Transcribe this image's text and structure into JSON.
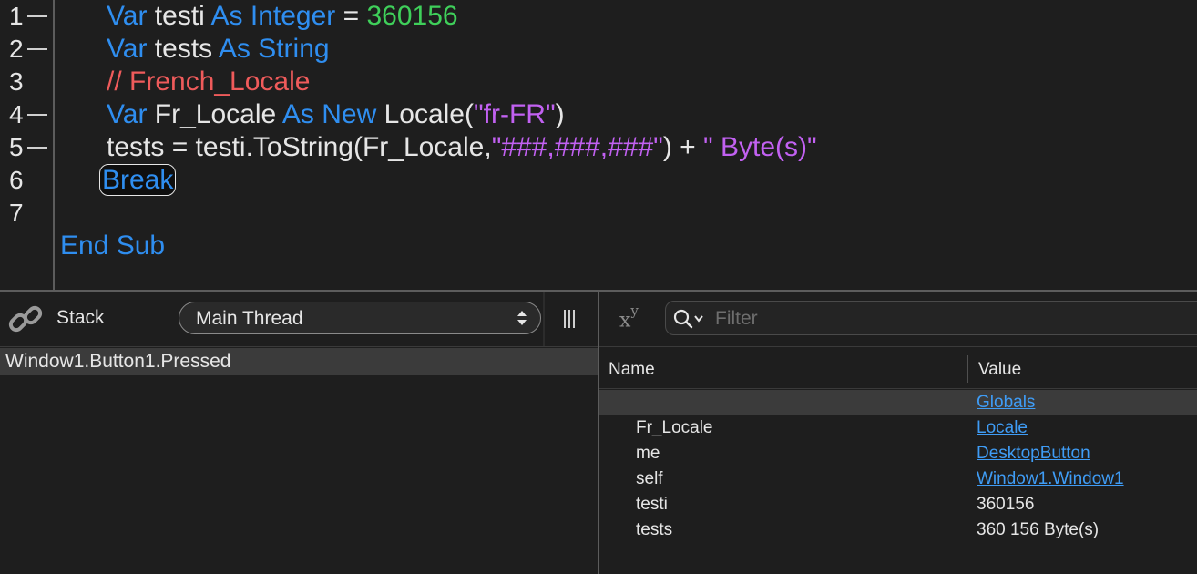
{
  "editor": {
    "line_numbers": [
      "1",
      "2",
      "3",
      "4",
      "5",
      "6",
      "7"
    ],
    "lines": {
      "l1": {
        "kw1": "Var",
        "name": " testi ",
        "kw2": "As Integer",
        "eq": " = ",
        "num": "360156"
      },
      "l2": {
        "kw1": "Var",
        "name": " tests ",
        "kw2": "As String"
      },
      "l3": {
        "comment": "// French_Locale"
      },
      "l4": {
        "kw1": "Var",
        "name": " Fr_Locale ",
        "kw2": "As New",
        "call": " Locale(",
        "str": "\"fr-FR\"",
        "close": ")"
      },
      "l5": {
        "p1": "tests = testi.ToString(Fr_Locale,",
        "str1": "\"###,###,###\"",
        "p2": ") + ",
        "str2": "\" Byte(s)\""
      },
      "l6": {
        "kw": "Break"
      },
      "end": {
        "kw": "End Sub"
      }
    }
  },
  "stack_pane": {
    "label": "Stack",
    "thread_select": "Main Thread",
    "rows": [
      "Window1.Button1.Pressed"
    ]
  },
  "vars_pane": {
    "filter_placeholder": "Filter",
    "col_name": "Name",
    "col_value": "Value",
    "rows": [
      {
        "name": "",
        "value": "Globals"
      },
      {
        "name": "Fr_Locale",
        "value": "Locale"
      },
      {
        "name": "me",
        "value": "DesktopButton"
      },
      {
        "name": "self",
        "value": "Window1.Window1"
      },
      {
        "name": "testi",
        "value": "360156"
      },
      {
        "name": "tests",
        "value": "360 156 Byte(s)"
      }
    ]
  },
  "colors": {
    "keyword": "#2f8ef0",
    "number": "#3fcf5a",
    "string": "#c261f2",
    "comment": "#ef5b5b",
    "link": "#3f9cf5"
  },
  "icons": [
    "link-chain-icon",
    "select-arrows-icon",
    "column-toggle-icon",
    "xy-variable-icon",
    "search-icon"
  ]
}
